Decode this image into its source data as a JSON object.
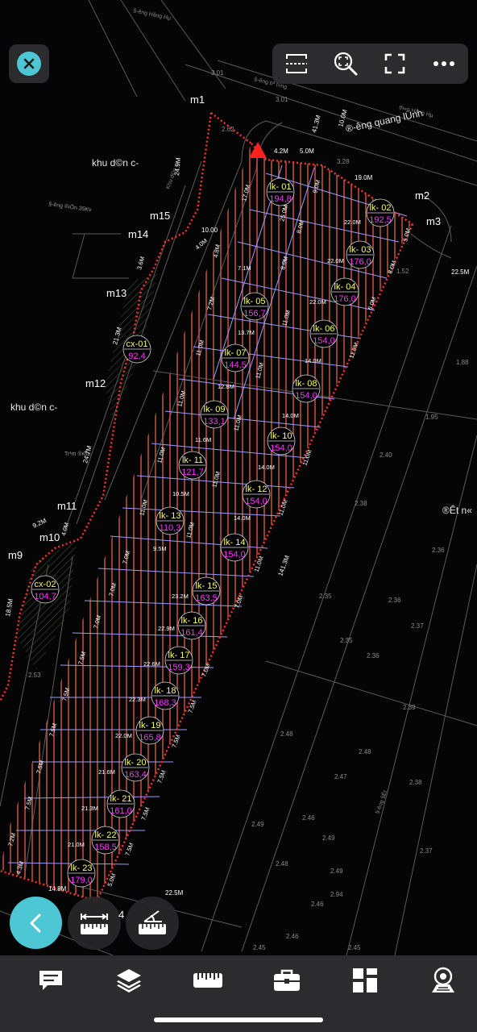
{
  "map": {
    "labels": {
      "m1": "m1",
      "m2": "m2",
      "m3": "m3",
      "m9": "m9",
      "m10": "m10",
      "m11": "m11",
      "m12": "m12",
      "m13": "m13",
      "m14": "m14",
      "m15": "m15",
      "road_name": "®-êng quang lÜnh",
      "khu_dan_cu_1": "khu d©n c-",
      "khu_dan_cu_2": "khu d©n c-",
      "dat_nong": "®Êt n«",
      "power_line": "§-êng ®iÖn 35Kv",
      "tram_dien": "Tr¹m ®iÖn",
      "road_top": "§-êng bª t«ng",
      "road_top2": "§-êng Hång Hµ",
      "road_top3": "th«n Hång Hµ",
      "khu_dan_cu_top": "Khu d©n c-",
      "road_right": "§-êng §Êt",
      "dist_41_3": "41.3M",
      "dist_10_0": "10.0M",
      "dist_5_0": "5.0M",
      "dist_4_2": "4.2M",
      "dist_19_0": "19.0M",
      "dist_22_5": "22.5M",
      "dist_141_3": "141.3M",
      "dist_24_7": "24.7M",
      "dist_21_3": "21.3M",
      "dist_24_9": "24.9M",
      "dist_10_00": "10.00",
      "dist_9_2": "9.2M",
      "dist_14_8": "14.8M",
      "dist_22_5b": "22.5M",
      "dist_18_5": "18.5M",
      "elev_3_01": "3.01",
      "elev_3_01b": "3.01",
      "elev_3_28": "3.28",
      "elev_2_62": "2.62",
      "elev_1_52": "1.52",
      "elev_1_88": "1.88",
      "elev_1_95": "1.95",
      "elev_2_40": "2.40",
      "elev_2_38": "2.38",
      "elev_2_36": "2.36",
      "elev_2_35": "2.35",
      "elev_2_37": "2.37",
      "elev_2_39": "2.39",
      "elev_2_48": "2.48",
      "elev_2_47": "2.47",
      "elev_2_49": "2.49",
      "elev_2_94": "2.94",
      "elev_2_46": "2.46",
      "elev_2_45": "2.45",
      "elev_2_53": "2.53"
    },
    "lots": [
      {
        "id": "lk- 01",
        "area": "194,8"
      },
      {
        "id": "lk- 02",
        "area": "192,5"
      },
      {
        "id": "lk- 03",
        "area": "176,0"
      },
      {
        "id": "lk- 04",
        "area": "176,0"
      },
      {
        "id": "lk- 05",
        "area": "156,7"
      },
      {
        "id": "lk- 06",
        "area": "154,0"
      },
      {
        "id": "lk- 07",
        "area": "144,5"
      },
      {
        "id": "lk- 08",
        "area": "154,0"
      },
      {
        "id": "lk- 09",
        "area": "133,1"
      },
      {
        "id": "lk- 10",
        "area": "154,0"
      },
      {
        "id": "lk- 11",
        "area": "121,7"
      },
      {
        "id": "lk- 12",
        "area": "154,0"
      },
      {
        "id": "lk- 13",
        "area": "110,3"
      },
      {
        "id": "lk- 14",
        "area": "154,0"
      },
      {
        "id": "lk- 15",
        "area": "163,5"
      },
      {
        "id": "lk- 16",
        "area": "161,4"
      },
      {
        "id": "lk- 17",
        "area": "159,3"
      },
      {
        "id": "lk- 18",
        "area": "168,3"
      },
      {
        "id": "lk- 19",
        "area": "165,8"
      },
      {
        "id": "lk- 20",
        "area": "163,4"
      },
      {
        "id": "lk- 21",
        "area": "161,0"
      },
      {
        "id": "lk- 22",
        "area": "158,5"
      },
      {
        "id": "lk- 23",
        "area": "179,0"
      },
      {
        "id": "cx-01",
        "area": "92,4"
      },
      {
        "id": "cx-02",
        "area": "104,7"
      }
    ],
    "lot_dims": {
      "d1": "17.0M",
      "d2": "25.0M",
      "d3": "8.0M",
      "d4": "9.0M",
      "d5": "22.0M",
      "d6": "22.0M",
      "d7": "22.0M",
      "d8": "8.0M",
      "d9": "6.0M",
      "d10": "7.1M",
      "d11": "8.0M",
      "d12": "11.0M",
      "d13": "13.7M",
      "d14": "11.0M",
      "d15": "14.0M",
      "d16": "11.0M",
      "d17": "12.8M",
      "d18": "11.0M",
      "d19": "14.0M",
      "d20": "11.0M",
      "d21": "11.6M",
      "d22": "11.0M",
      "d23": "14.0M",
      "d24": "11.0M",
      "d25": "10.5M",
      "d26": "11.0M",
      "d27": "14.0M",
      "d28": "11.0M",
      "d29": "9.5M",
      "d30": "11.0M",
      "d31": "23.2M",
      "d32": "7.0M",
      "d33": "22.9M",
      "d34": "7.0M",
      "d35": "22.6M",
      "d36": "7.0M",
      "d37": "22.3M",
      "d38": "7.5M",
      "d39": "22.0M",
      "d40": "7.5M",
      "d41": "21.6M",
      "d42": "7.5M",
      "d43": "21.3M",
      "d44": "7.5M",
      "d45": "21.0M",
      "d46": "7.5M",
      "d47": "7.2M",
      "d48": "4.3M",
      "d49": "5.0M",
      "d50": "2.5M",
      "d51": "3.6M",
      "d52": "4.8M",
      "d53": "4.0M",
      "d54": "4.3M",
      "d55": "7.2M",
      "d56": "7.5M",
      "d57": "7.5M",
      "d58": "7.5M",
      "d59": "7.0M",
      "d60": "7.5M",
      "d61": "7.2M"
    }
  },
  "toolbar": {
    "close_icon": "close-icon",
    "buttons": [
      "fit-width-icon",
      "zoom-window-icon",
      "fullscreen-icon",
      "more-icon"
    ]
  },
  "bottom_tools": {
    "back_icon": "chevron-left-icon",
    "measure_distance_icon": "ruler-distance-icon",
    "measure_angle_icon": "ruler-angle-icon",
    "fab_label": "4"
  },
  "bottom_bar": {
    "items": [
      "comment-icon",
      "layers-icon",
      "ruler-icon",
      "toolbox-icon",
      "layout-grid-icon",
      "viewpoint-icon"
    ]
  },
  "colors": {
    "accent": "#4cc7d3",
    "panel": "#2c2c2e",
    "lot_id": "#ffff66",
    "lot_area": "#ff33ff",
    "boundary": "#ff3030",
    "hatch": "#b8503a"
  }
}
